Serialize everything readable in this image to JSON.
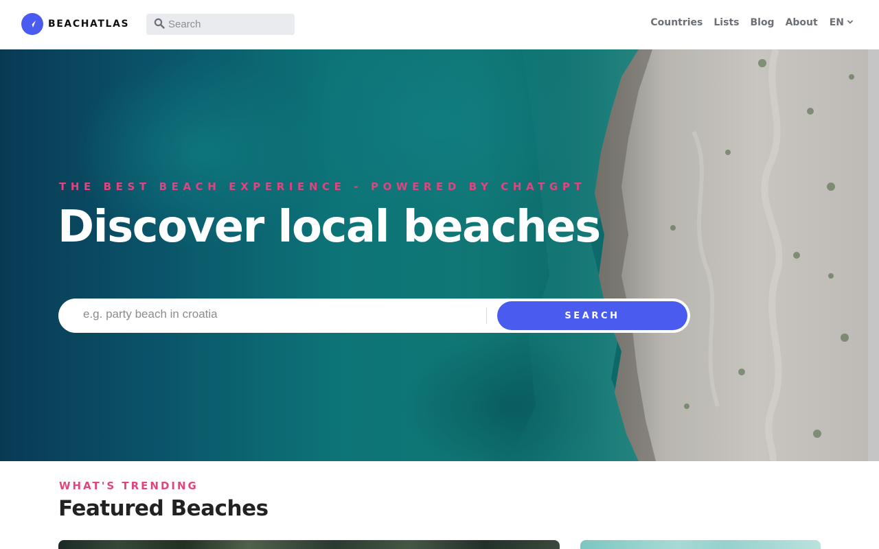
{
  "header": {
    "brand": "BEACHATLAS",
    "search_placeholder": "Search",
    "nav": {
      "countries": "Countries",
      "lists": "Lists",
      "blog": "Blog",
      "about": "About",
      "language": "EN"
    }
  },
  "hero": {
    "tagline": "THE BEST BEACH EXPERIENCE - POWERED BY CHATGPT",
    "title": "Discover local beaches",
    "search_placeholder": "e.g. party beach in croatia",
    "search_button": "SEARCH"
  },
  "trending": {
    "kicker": "WHAT'S TRENDING",
    "title": "Featured Beaches"
  },
  "colors": {
    "accent": "#4a5cf0",
    "pink": "#e0457f",
    "nav_text": "#6b6f76"
  },
  "icons": {
    "logo": "compass-icon",
    "search": "search-icon",
    "language": "chevron-down-icon"
  }
}
